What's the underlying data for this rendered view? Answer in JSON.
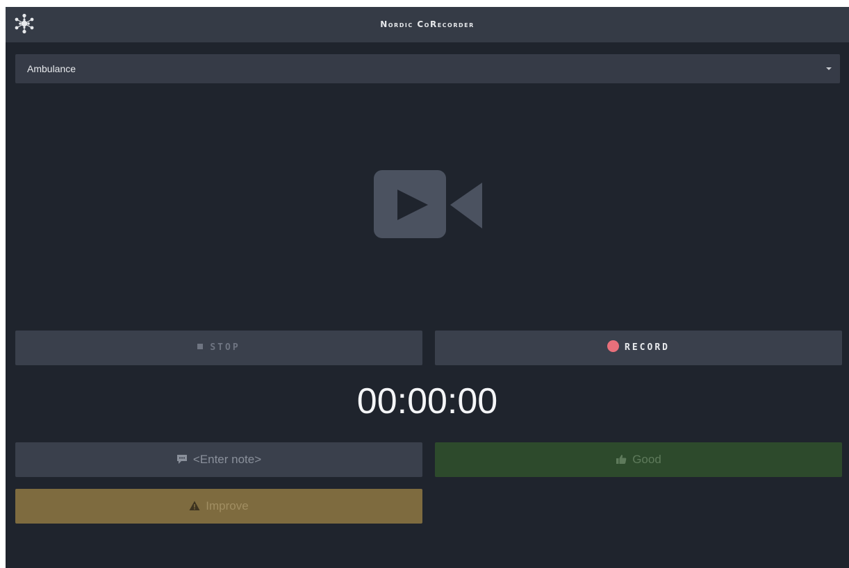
{
  "app": {
    "title": "Nordic CoRecorder",
    "logo_icon": "molecule-logo-icon"
  },
  "profile_select": {
    "value": "Ambulance"
  },
  "video": {
    "placeholder_icon": "video-camera-icon"
  },
  "controls": {
    "stop_label": "STOP",
    "record_label": "RECORD",
    "timer": "00:00:00",
    "note_label": "<Enter note>",
    "good_label": "Good",
    "improve_label": "Improve"
  },
  "colors": {
    "background": "#1f242d",
    "titlebar": "#353b46",
    "button": "#3a404c",
    "record_dot": "#e8707b",
    "good": "#2d4a2c",
    "improve": "#7e6b3f"
  }
}
